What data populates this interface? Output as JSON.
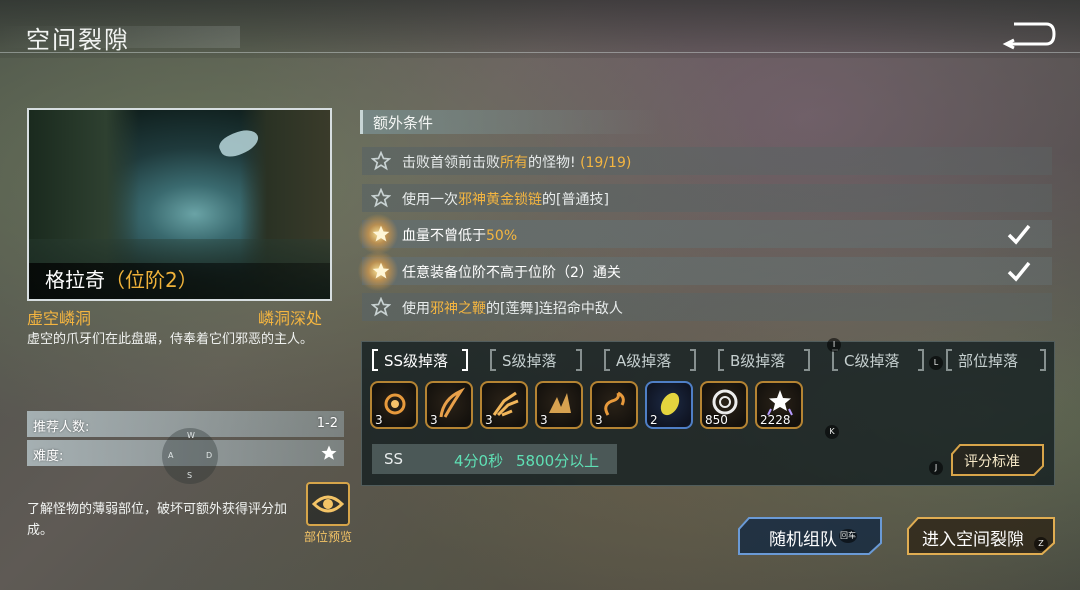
{
  "header": {
    "title": "空间裂隙",
    "back_icon": "return-arrow-icon"
  },
  "boss": {
    "name": "格拉奇",
    "tier": "（位阶2）",
    "subtitle": "虚空嶙洞",
    "area": "嶙洞深处",
    "description": "虚空的爪牙们在此盘踞，侍奉着它们邪恶的主人。"
  },
  "info": {
    "recommended_label": "推荐人数:",
    "recommended_value": "1-2",
    "difficulty_label": "难度:",
    "difficulty_stars": 1
  },
  "hint": "了解怪物的薄弱部位，破坏可额外获得评分加成。",
  "preview_button": {
    "label": "部位预览",
    "icon": "eye-icon"
  },
  "joystick": {
    "w": "W",
    "a": "A",
    "s": "S",
    "d": "D"
  },
  "conditions": {
    "header": "额外条件",
    "items": [
      {
        "pre": "击败首领前击败",
        "hl": "所有",
        "post": "的怪物! ",
        "hl2": "(19/19)",
        "done": false
      },
      {
        "pre": "使用一次",
        "hl": "邪神黄金锁链",
        "post": "的[普通技]",
        "hl2": "",
        "done": false
      },
      {
        "pre": "血量不曾低于",
        "hl": "50%",
        "post": "",
        "hl2": "",
        "done": true
      },
      {
        "pre": "任意装备位阶不高于位阶（2）通关",
        "hl": "",
        "post": "",
        "hl2": "",
        "done": true
      },
      {
        "pre": "使用",
        "hl": "邪神之鞭",
        "post": "的[莲舞]连招命中敌人",
        "hl2": "",
        "done": false
      }
    ]
  },
  "drops": {
    "tabs": [
      "SS级掉落",
      "S级掉落",
      "A级掉落",
      "B级掉落",
      "C级掉落",
      "部位掉落"
    ],
    "active_tab": 0,
    "items": [
      {
        "icon": "orb-shard-icon",
        "count": "3",
        "rarity": "gold"
      },
      {
        "icon": "feather-icon",
        "count": "3",
        "rarity": "gold"
      },
      {
        "icon": "claw-icon",
        "count": "3",
        "rarity": "gold"
      },
      {
        "icon": "wing-icon",
        "count": "3",
        "rarity": "gold"
      },
      {
        "icon": "hook-icon",
        "count": "3",
        "rarity": "gold"
      },
      {
        "icon": "gem-icon",
        "count": "2",
        "rarity": "blue"
      },
      {
        "icon": "coin-icon",
        "count": "850",
        "rarity": "gold"
      },
      {
        "icon": "star-token-icon",
        "count": "2228",
        "rarity": "gold"
      }
    ],
    "score": {
      "grade": "SS",
      "time": "4分0秒",
      "points": "5800分以上"
    },
    "criteria_label": "评分标准"
  },
  "keys": {
    "i": "I",
    "l": "L",
    "k": "K",
    "j": "J",
    "enter": "回车",
    "hold": "Z"
  },
  "actions": {
    "random_team": "随机组队",
    "enter": "进入空间裂隙"
  },
  "colors": {
    "accent": "#f4b540",
    "score": "#5fe0b5"
  }
}
